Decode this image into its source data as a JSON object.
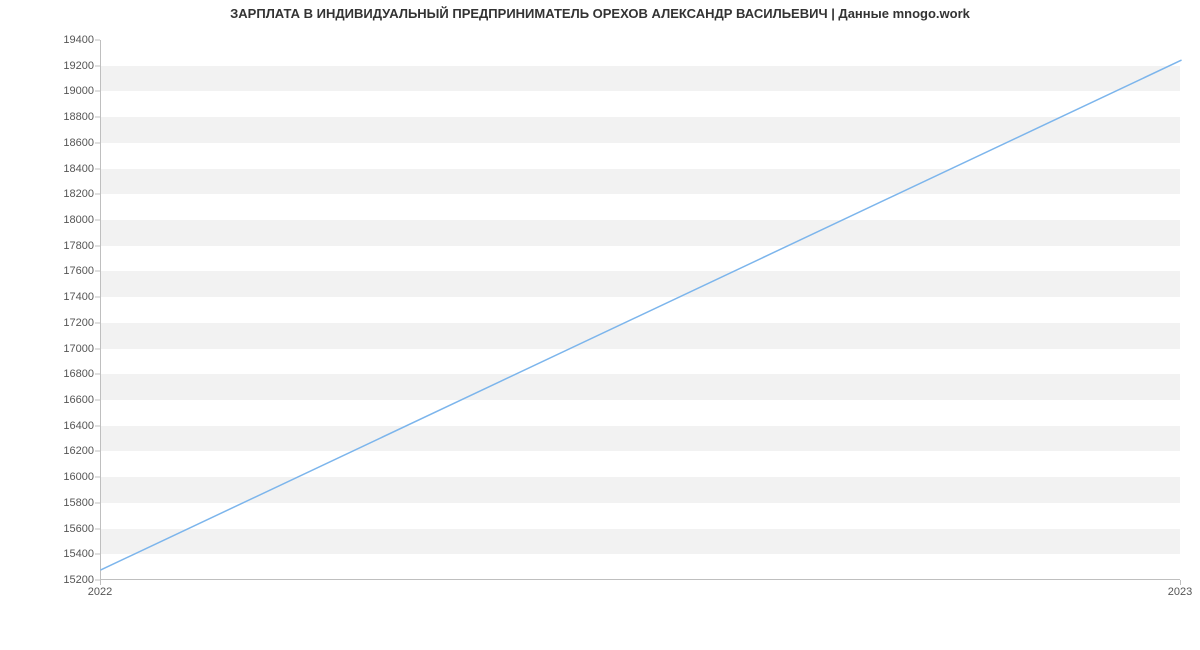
{
  "chart_data": {
    "type": "line",
    "title": "ЗАРПЛАТА В ИНДИВИДУАЛЬНЫЙ ПРЕДПРИНИМАТЕЛЬ ОРЕХОВ АЛЕКСАНДР ВАСИЛЬЕВИЧ | Данные mnogo.work",
    "x": [
      2022,
      2023
    ],
    "values": [
      15279,
      19242
    ],
    "xlabel": "",
    "ylabel": "",
    "xlim": [
      2022,
      2023
    ],
    "ylim": [
      15200,
      19400
    ],
    "y_ticks": [
      15200,
      15400,
      15600,
      15800,
      16000,
      16200,
      16400,
      16600,
      16800,
      17000,
      17200,
      17400,
      17600,
      17800,
      18000,
      18200,
      18400,
      18600,
      18800,
      19000,
      19200,
      19400
    ],
    "x_ticks": [
      2022,
      2023
    ],
    "line_color": "#7cb5ec",
    "band_color": "#f2f2f2"
  }
}
